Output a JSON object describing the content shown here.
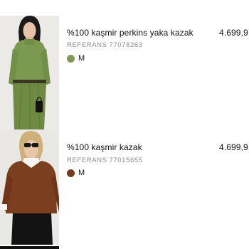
{
  "items": [
    {
      "title": "%100 kaşmir perkins yaka kazak",
      "price": "4.699,9",
      "ref_label": "REFERANS",
      "ref_number": "77078263",
      "color": "#7e9a54",
      "size": "M"
    },
    {
      "title": "%100 kaşmir kazak",
      "price": "4.699,9",
      "ref_label": "REFERANS",
      "ref_number": "77015655",
      "color": "#7a3a1c",
      "size": "M"
    }
  ],
  "colors": {
    "background": "#ffffff",
    "text": "#111111",
    "muted": "#8a8a8a"
  }
}
